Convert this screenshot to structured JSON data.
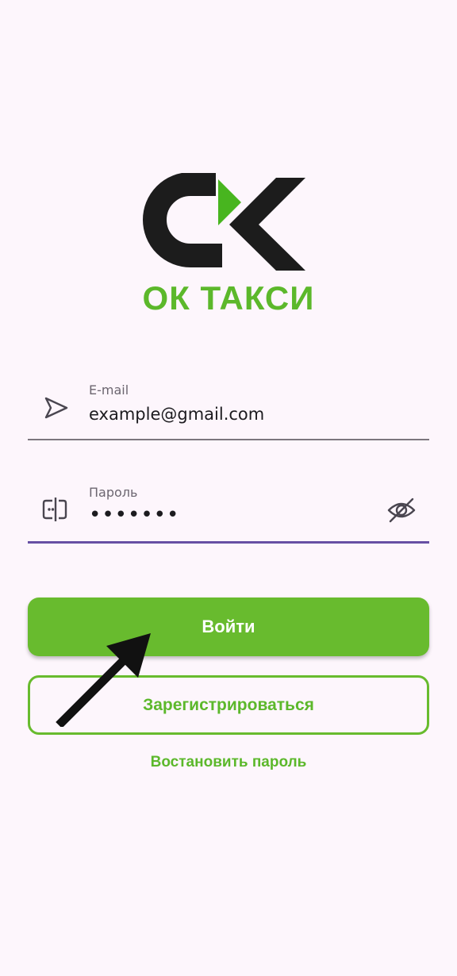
{
  "brand": {
    "logo_icon": "ok-taxi-logo",
    "name": "ОК ТАКСИ",
    "color": "#5cb82b"
  },
  "form": {
    "email": {
      "label": "E-mail",
      "value": "example@gmail.com",
      "icon": "send-arrow-icon"
    },
    "password": {
      "label": "Пароль",
      "value": "•••••••",
      "icon": "password-field-icon",
      "toggle_icon": "eye-off-icon"
    }
  },
  "actions": {
    "login_label": "Войти",
    "register_label": "Зарегистрироваться",
    "restore_label": "Востановить пароль"
  },
  "colors": {
    "background": "#fdf6fc",
    "accent": "#68bb2e",
    "focus_underline": "#6750a4",
    "text": "#1c1b1f"
  }
}
